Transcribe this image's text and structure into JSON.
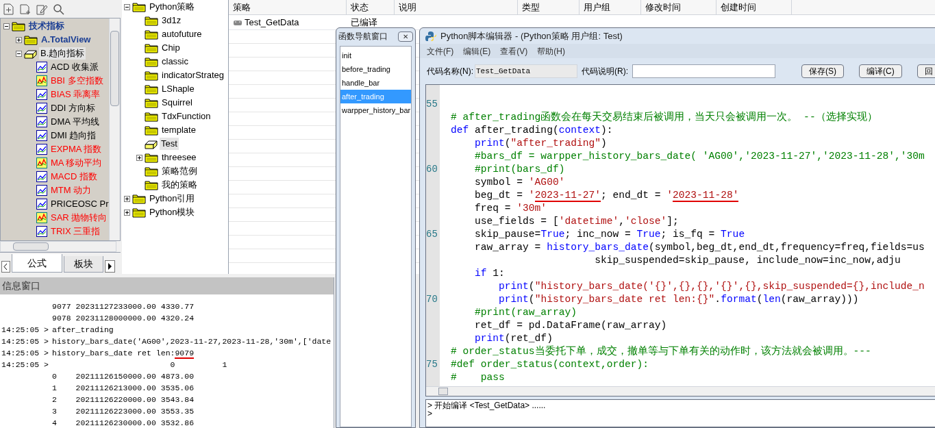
{
  "indicator_tree": [
    {
      "label": "技术指标",
      "kind": "category",
      "expanded": true,
      "selected": false,
      "children": [
        {
          "label": "A.TotalView",
          "kind": "category",
          "expanded": false,
          "selected": false
        },
        {
          "label": "B.趋向指标",
          "kind": "category",
          "expanded": true,
          "selected": true,
          "children": [
            {
              "label": "ACD 收集派",
              "kind": "formula",
              "color": "#000000",
              "selected": false
            },
            {
              "label": "BBI 多空指数",
              "kind": "formula_special",
              "color": "#ff0000",
              "selected": false
            },
            {
              "label": "BIAS 乖离率",
              "kind": "formula",
              "color": "#ff0000",
              "selected": false
            },
            {
              "label": "DDI 方向标",
              "kind": "formula",
              "color": "#000000",
              "selected": false
            },
            {
              "label": "DMA 平均线",
              "kind": "formula",
              "color": "#000000",
              "selected": false
            },
            {
              "label": "DMI 趋向指",
              "kind": "formula",
              "color": "#000000",
              "selected": false
            },
            {
              "label": "EXPMA 指数",
              "kind": "formula",
              "color": "#ff0000",
              "selected": false
            },
            {
              "label": "MA 移动平均",
              "kind": "formula_special",
              "color": "#ff0000",
              "selected": false
            },
            {
              "label": "MACD 指数",
              "kind": "formula",
              "color": "#ff0000",
              "selected": false
            },
            {
              "label": "MTM 动力",
              "kind": "formula",
              "color": "#ff0000",
              "selected": false
            },
            {
              "label": "PRICEOSC Pr",
              "kind": "formula",
              "color": "#000000",
              "selected": false
            },
            {
              "label": "SAR 抛物转向",
              "kind": "formula_special",
              "color": "#ff0000",
              "selected": false
            },
            {
              "label": "TRIX 三重指",
              "kind": "formula",
              "color": "#ff0000",
              "selected": false
            }
          ]
        }
      ]
    }
  ],
  "left_tabs": [
    {
      "label": "公式",
      "selected": true
    },
    {
      "label": "板块",
      "selected": false
    }
  ],
  "strategy_tree": [
    {
      "label": "Python策略",
      "expanded": true,
      "selected": false,
      "children": [
        {
          "label": "3d1z",
          "selected": false
        },
        {
          "label": "autofuture",
          "selected": false
        },
        {
          "label": "Chip",
          "selected": false
        },
        {
          "label": "classic",
          "selected": false
        },
        {
          "label": "indicatorStrateg",
          "selected": false
        },
        {
          "label": "LShaple",
          "selected": false
        },
        {
          "label": "Squirrel",
          "selected": false
        },
        {
          "label": "TdxFunction",
          "selected": false
        },
        {
          "label": "template",
          "selected": false
        },
        {
          "label": "Test",
          "selected": true
        },
        {
          "label": "threesee",
          "expanded": false,
          "selected": false
        },
        {
          "label": "策略范例",
          "selected": false
        },
        {
          "label": "我的策略",
          "selected": false
        }
      ]
    },
    {
      "label": "Python引用",
      "expanded": false,
      "selected": false
    },
    {
      "label": "Python模块",
      "expanded": false,
      "selected": false
    }
  ],
  "table": {
    "columns": [
      "策略",
      "状态",
      "说明",
      "类型",
      "用户组",
      "修改时间",
      "创建时间"
    ],
    "rows": [
      [
        "Test_GetData",
        "已编译"
      ]
    ]
  },
  "info_window": {
    "title": "信息窗口",
    "lines": [
      {
        "text": "9077 20231127233000.00 4330.77"
      },
      {
        "text": "9078 20231128000000.00 4320.24"
      },
      {
        "time": "14:25:05 >",
        "text": "after_trading"
      },
      {
        "time": "14:25:05 >",
        "text": "history_bars_date('AG00',2023-11-27,2023-11-28,'30m',['date"
      },
      {
        "time": "14:25:05 >",
        "text": "history_bars_date ret len:",
        "underlined_text": "9079"
      },
      {
        "time": "14:25:05 >",
        "text": "                         0          1"
      },
      {
        "text": "0    20211126150000.00 4873.00"
      },
      {
        "text": "1    20211126213000.00 3535.06"
      },
      {
        "text": "2    20211126220000.00 3543.84"
      },
      {
        "text": "3    20211126223000.00 3553.35"
      },
      {
        "text": "4    20211126230000.00 3532.86"
      }
    ]
  },
  "function_nav": {
    "title": "函数导航窗口",
    "close": "✕",
    "items": [
      {
        "label": "init",
        "selected": false
      },
      {
        "label": "before_trading",
        "selected": false
      },
      {
        "label": "handle_bar",
        "selected": false
      },
      {
        "label": "after_trading",
        "selected": true
      },
      {
        "label": "warpper_history_bar",
        "selected": false
      }
    ]
  },
  "editor": {
    "title": "Python脚本编辑器 - (Python策略 用户组: Test)",
    "menu": [
      "文件(F)",
      "编辑(E)",
      "查看(V)",
      "帮助(H)"
    ],
    "name_label": "代码名称(N):",
    "name_value": "Test_GetData",
    "desc_label": "代码说明(R):",
    "buttons": [
      "保存(S)",
      "编译(C)",
      "回"
    ],
    "code_lines": [
      {
        "number": "55"
      },
      {
        "segments": [
          {
            "text": "# after_trading函数会在每天交易结束后被调用，当天只会被调用一次。 --（选择实现）",
            "kind": "comment"
          }
        ]
      },
      {
        "segments": [
          {
            "text": "def",
            "kind": "keyword"
          },
          {
            "text": " after_trading(",
            "kind": "plain"
          },
          {
            "text": "context",
            "kind": "keyword"
          },
          {
            "text": "):",
            "kind": "plain"
          }
        ]
      },
      {
        "segments": [
          {
            "text": "    print",
            "kind": "keyword"
          },
          {
            "text": "(",
            "kind": "plain"
          },
          {
            "text": "\"after_trading\"",
            "kind": "string"
          },
          {
            "text": ")",
            "kind": "plain"
          }
        ]
      },
      {
        "segments": [
          {
            "text": "    #bars_df = warpper_history_bars_date( 'AG00','2023-11-27','2023-11-28','30m",
            "kind": "comment"
          }
        ]
      },
      {
        "number": "60",
        "segments": [
          {
            "text": "    #print(bars_df)",
            "kind": "comment"
          }
        ]
      },
      {
        "segments": [
          {
            "text": "    symbol = ",
            "kind": "plain"
          },
          {
            "text": "'AG00'",
            "kind": "string"
          }
        ]
      },
      {
        "segments": [
          {
            "text": "    beg_dt = ",
            "kind": "plain"
          },
          {
            "text": "'",
            "kind": "string"
          },
          {
            "text": "2023-11-27'",
            "kind": "string",
            "underlined": true
          },
          {
            "text": "; end_dt = ",
            "kind": "plain"
          },
          {
            "text": "'",
            "kind": "string"
          },
          {
            "text": "2023-11-28'",
            "kind": "string",
            "underlined": true
          }
        ]
      },
      {
        "segments": [
          {
            "text": "    freq = ",
            "kind": "plain"
          },
          {
            "text": "'30m'",
            "kind": "string"
          }
        ]
      },
      {
        "segments": [
          {
            "text": "    use_fields = [",
            "kind": "plain"
          },
          {
            "text": "'datetime'",
            "kind": "string"
          },
          {
            "text": ",",
            "kind": "plain"
          },
          {
            "text": "'close'",
            "kind": "string"
          },
          {
            "text": "];",
            "kind": "plain"
          }
        ]
      },
      {
        "number": "65",
        "segments": [
          {
            "text": "    skip_pause=",
            "kind": "plain"
          },
          {
            "text": "True",
            "kind": "keyword"
          },
          {
            "text": "; inc_now = ",
            "kind": "plain"
          },
          {
            "text": "True",
            "kind": "keyword"
          },
          {
            "text": "; is_fq = ",
            "kind": "plain"
          },
          {
            "text": "True",
            "kind": "keyword"
          }
        ]
      },
      {
        "segments": [
          {
            "text": "    raw_array = ",
            "kind": "plain"
          },
          {
            "text": "history_bars_date",
            "kind": "keyword"
          },
          {
            "text": "(symbol,beg_dt,end_dt,frequency=freq,fields=us",
            "kind": "plain"
          }
        ]
      },
      {
        "segments": [
          {
            "text": "                        skip_suspended=skip_pause, include_now=inc_now,adju",
            "kind": "plain"
          }
        ]
      },
      {
        "segments": [
          {
            "text": "    if",
            "kind": "keyword"
          },
          {
            "text": " 1:",
            "kind": "plain"
          }
        ]
      },
      {
        "segments": [
          {
            "text": "        print",
            "kind": "keyword"
          },
          {
            "text": "(",
            "kind": "plain"
          },
          {
            "text": "\"history_bars_date('{}',{},{},'{}',{},skip_suspended={},include_n",
            "kind": "string"
          }
        ]
      },
      {
        "number": "70",
        "segments": [
          {
            "text": "        print",
            "kind": "keyword"
          },
          {
            "text": "(",
            "kind": "plain"
          },
          {
            "text": "\"history_bars_date ret len:{}\"",
            "kind": "string"
          },
          {
            "text": ".",
            "kind": "plain"
          },
          {
            "text": "format",
            "kind": "keyword"
          },
          {
            "text": "(",
            "kind": "plain"
          },
          {
            "text": "len",
            "kind": "keyword"
          },
          {
            "text": "(raw_array)))",
            "kind": "plain"
          }
        ]
      },
      {
        "segments": [
          {
            "text": "    #print(raw_array)",
            "kind": "comment"
          }
        ]
      },
      {
        "segments": [
          {
            "text": "    ret_df = pd.DataFrame(raw_array)",
            "kind": "plain"
          }
        ]
      },
      {
        "segments": [
          {
            "text": "    print",
            "kind": "keyword"
          },
          {
            "text": "(ret_df)",
            "kind": "plain"
          }
        ]
      },
      {
        "segments": [
          {
            "text": "# order_status当委托下单，成交，撤单等与下单有关的动作时，该方法就会被调用。---",
            "kind": "comment"
          }
        ]
      },
      {
        "number": "75",
        "segments": [
          {
            "text": "#def order_status(context,order):",
            "kind": "comment"
          }
        ]
      },
      {
        "segments": [
          {
            "text": "#    pass",
            "kind": "comment"
          }
        ]
      }
    ],
    "output": [
      "> 开始编译 <Test_GetData> ......",
      ">"
    ]
  }
}
